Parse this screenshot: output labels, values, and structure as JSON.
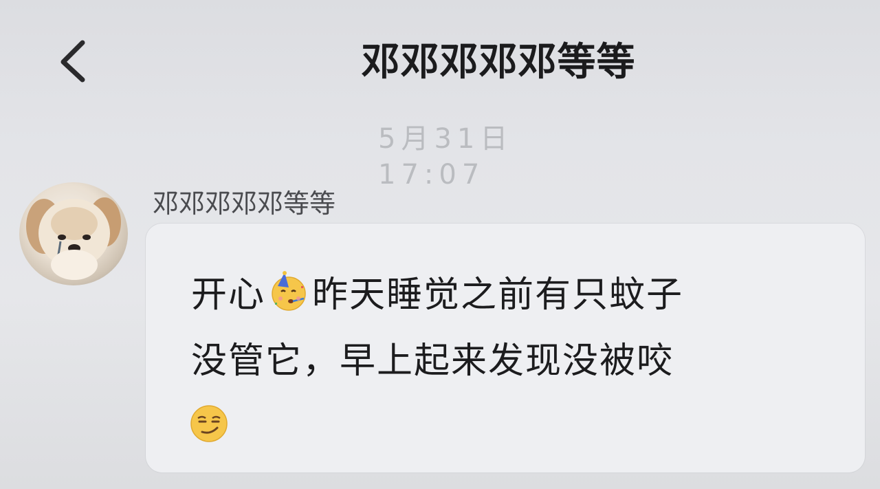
{
  "header": {
    "back_icon": "chevron-left-icon",
    "title": "邓邓邓邓邓等等"
  },
  "timestamp": "5月31日 17:07",
  "message": {
    "avatar_icon": "puppy-avatar",
    "sender": "邓邓邓邓邓等等",
    "line1_before": "开心",
    "emoji1": "partying-face-emoji",
    "line1_after": "昨天睡觉之前有只蚊子",
    "line2": "没管它，早上起来发现没被咬",
    "emoji2": "smirking-face-emoji"
  }
}
